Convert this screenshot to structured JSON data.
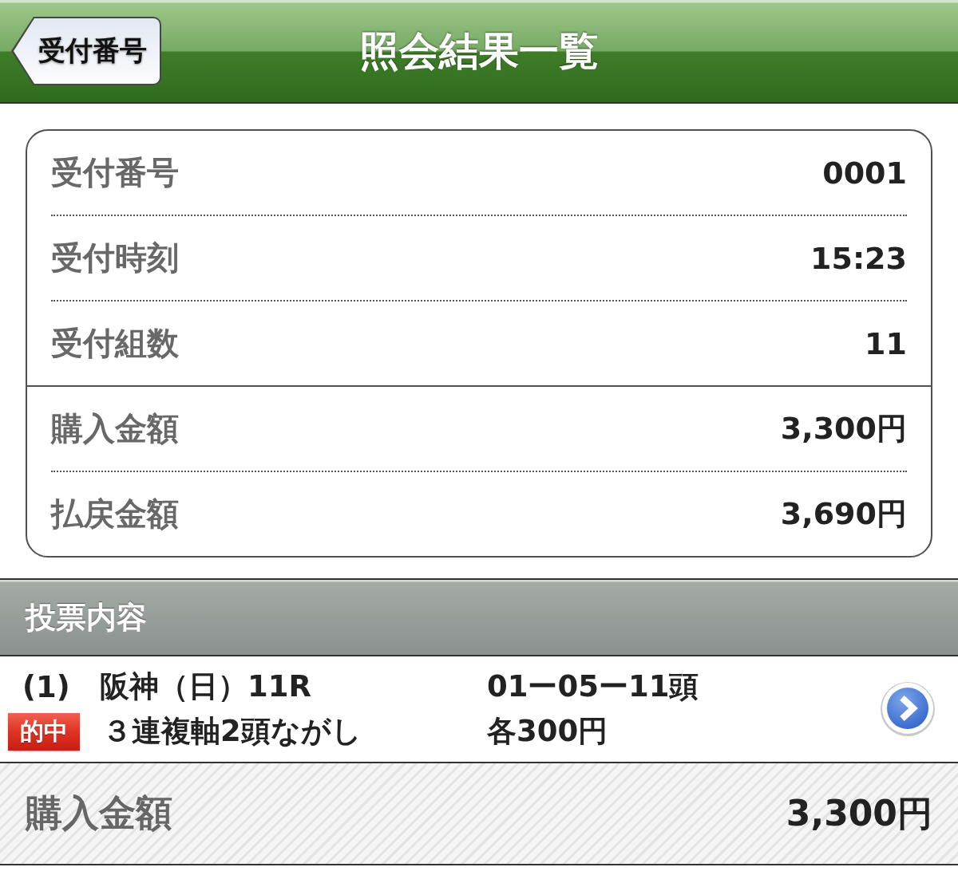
{
  "nav": {
    "back_button": "受付番号",
    "title": "照会結果一覧"
  },
  "summary": {
    "groups": [
      {
        "rows": [
          {
            "label": "受付番号",
            "value": "0001"
          },
          {
            "label": "受付時刻",
            "value": "15:23"
          },
          {
            "label": "受付組数",
            "value": "11"
          }
        ]
      },
      {
        "rows": [
          {
            "label": "購入金額",
            "value": "3,300円"
          },
          {
            "label": "払戻金額",
            "value": "3,690円"
          }
        ]
      }
    ]
  },
  "section_header": "投票内容",
  "bets": [
    {
      "number": "(1)",
      "race": "阪神（日）11R",
      "horses": "01ー05ー11頭",
      "badge": "的中",
      "bet_type": "３連複軸2頭ながし",
      "amount": "各300円"
    }
  ],
  "total": {
    "label": "購入金額",
    "value": "3,300円"
  }
}
